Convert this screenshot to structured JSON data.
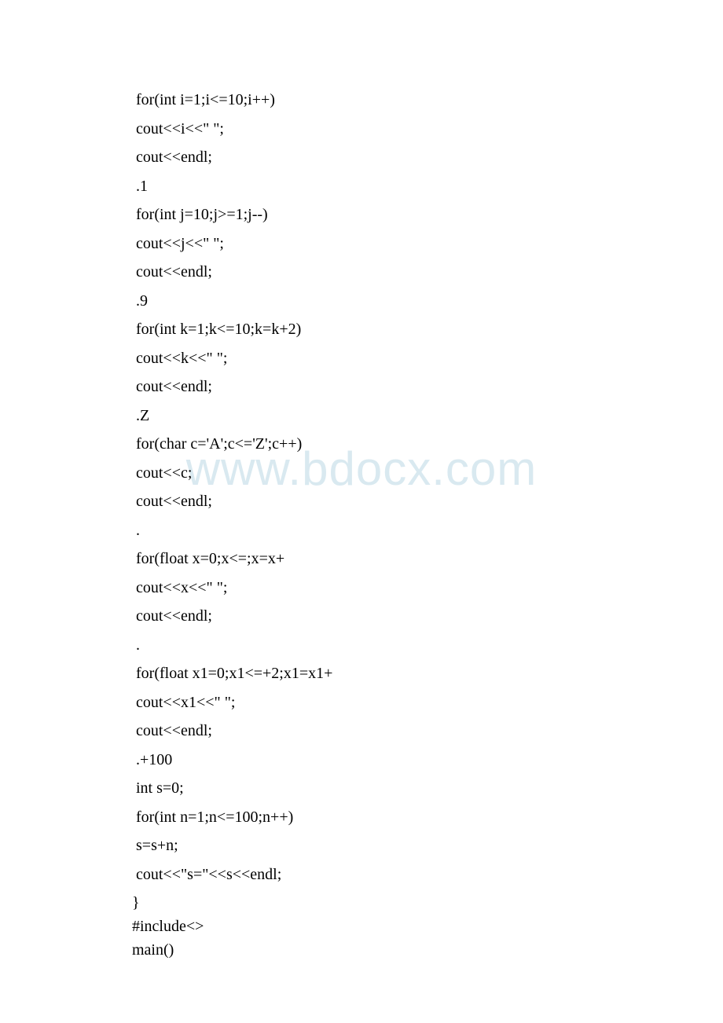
{
  "watermark": "www.bdocx.com",
  "lines": [
    " for(int i=1;i<=10;i++)",
    " cout<<i<<\" \";",
    " cout<<endl;",
    " .1",
    " for(int j=10;j>=1;j--)",
    " cout<<j<<\" \";",
    " cout<<endl;",
    " .9",
    " for(int k=1;k<=10;k=k+2)",
    " cout<<k<<\" \";",
    " cout<<endl;",
    " .Z",
    " for(char c='A';c<='Z';c++)",
    " cout<<c;",
    " cout<<endl;",
    " .",
    " for(float x=0;x<=;x=x+",
    " cout<<x<<\" \";",
    " cout<<endl;",
    " .",
    " for(float x1=0;x1<=+2;x1=x1+",
    " cout<<x1<<\" \";",
    " cout<<endl;",
    " .+100",
    " int s=0;",
    " for(int n=1;n<=100;n++)",
    " s=s+n;",
    " cout<<\"s=\"<<s<<endl;",
    "}",
    "#include<>",
    "main()"
  ]
}
